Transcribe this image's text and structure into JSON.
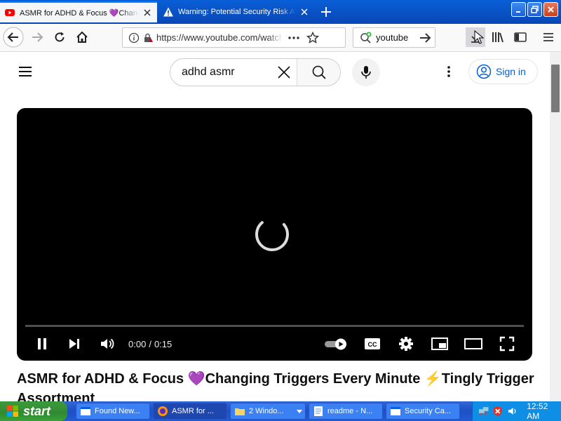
{
  "browser": {
    "tabs": [
      {
        "title": "ASMR for ADHD & Focus 💜Changing Triggers Every Minute ⚡Tingly Trigger Assortment",
        "active": true,
        "favicon": "youtube-icon"
      },
      {
        "title": "Warning: Potential Security Risk Ahead",
        "active": false,
        "favicon": "warning-icon"
      }
    ],
    "url": "https://www.youtube.com/watch",
    "search_text": "youtube"
  },
  "youtube": {
    "search_query": "adhd asmr",
    "sign_in_label": "Sign in",
    "player": {
      "current_time": "0:00",
      "separator": "/",
      "duration": "0:15",
      "progress_fraction": 0.0,
      "loading": true
    },
    "video_title": "ASMR for ADHD & Focus 💜Changing Triggers Every Minute ⚡Tingly Trigger Assortment"
  },
  "taskbar": {
    "start_label": "start",
    "tasks": [
      {
        "label": "Found New...",
        "icon": "window-icon"
      },
      {
        "label": "ASMR for ...",
        "icon": "firefox-icon",
        "active": true
      },
      {
        "label": "2 Windo...",
        "icon": "folder-icon"
      },
      {
        "label": "readme - N...",
        "icon": "notepad-icon"
      },
      {
        "label": "Security Ca...",
        "icon": "window-icon"
      }
    ],
    "clock": "12:52 AM"
  },
  "colors": {
    "taskbar": "#245ad4",
    "start": "#2f8a2f",
    "tray": "#0f8ee6",
    "yt_accent": "#065fd4",
    "player_bg": "#000000"
  }
}
